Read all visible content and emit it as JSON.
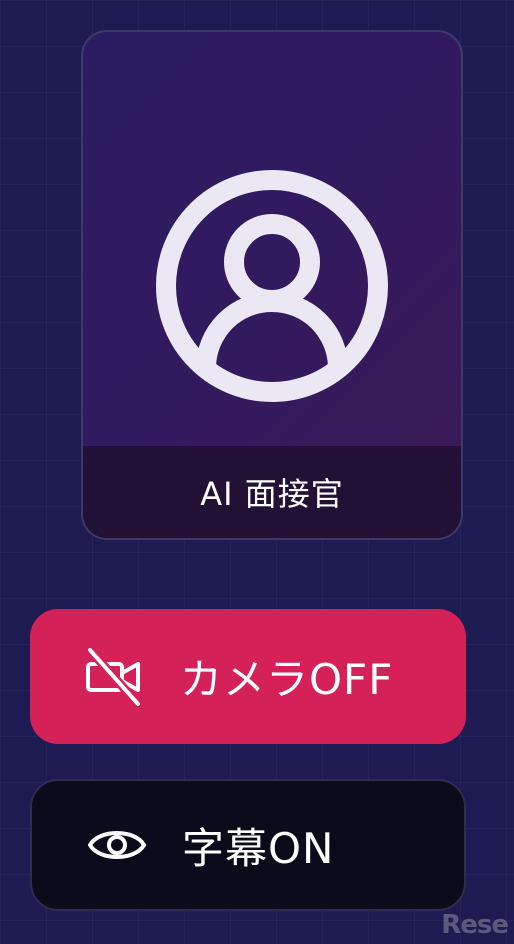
{
  "ai_card": {
    "caption": "AI 面接官",
    "avatar_icon": "user-circle-icon"
  },
  "buttons": {
    "camera": {
      "label": "カメラOFF",
      "icon": "camera-off-icon",
      "color": "#d42158"
    },
    "subtitles": {
      "label": "字幕ON",
      "icon": "eye-icon",
      "color": "#0b0b1c"
    }
  },
  "watermark": {
    "text": "Rese"
  },
  "theme": {
    "background": "#1e1b52",
    "card_gradient_start": "#2a1c63",
    "card_caption_bg": "#231035"
  }
}
